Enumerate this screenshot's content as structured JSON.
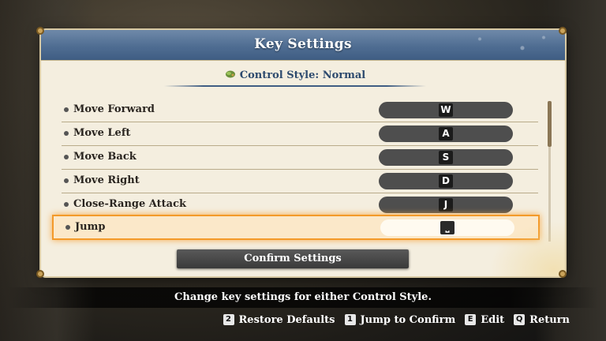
{
  "dialog": {
    "title": "Key Settings",
    "control_style": "Control Style: Normal",
    "confirm_label": "Confirm Settings"
  },
  "bindings": [
    {
      "action": "Move Forward",
      "key": "W"
    },
    {
      "action": "Move Left",
      "key": "A"
    },
    {
      "action": "Move Back",
      "key": "S"
    },
    {
      "action": "Move Right",
      "key": "D"
    },
    {
      "action": "Close-Range Attack",
      "key": "J"
    },
    {
      "action": "Jump",
      "key": "⎵",
      "selected": true
    }
  ],
  "help_text": "Change key settings for either Control Style.",
  "footer": [
    {
      "key": "2",
      "label": "Restore Defaults"
    },
    {
      "key": "1",
      "label": "Jump to Confirm"
    },
    {
      "key": "E",
      "label": "Edit"
    },
    {
      "key": "Q",
      "label": "Return"
    }
  ],
  "colors": {
    "title_bar": "#4f6d92",
    "panel": "#f4eedf",
    "highlight": "#f39a2a",
    "key_pill": "#4e4e4e"
  },
  "icons": {
    "control_style": "leaf-icon",
    "row_marker": "bullet-icon"
  }
}
